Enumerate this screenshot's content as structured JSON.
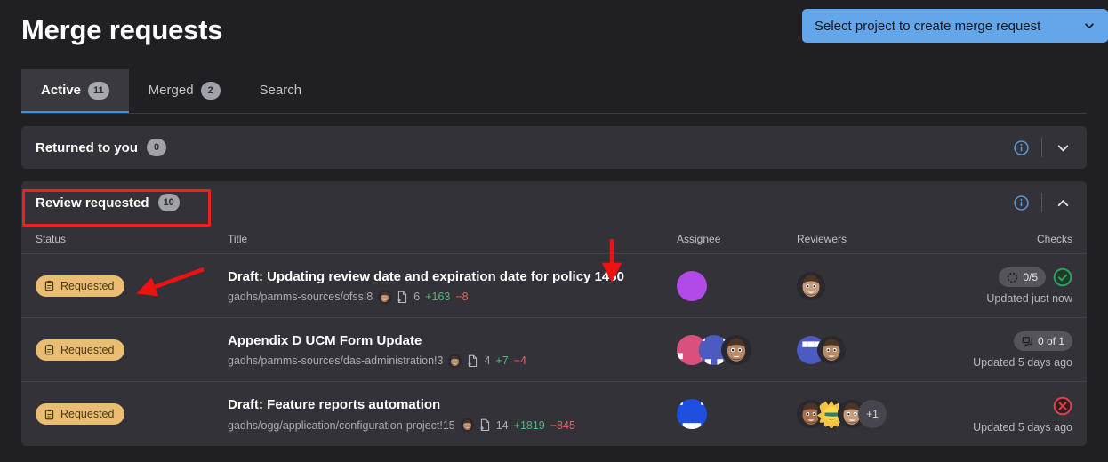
{
  "header": {
    "title": "Merge requests",
    "create_button": {
      "label": "Select project to create merge request",
      "icon": "chevron-down-icon",
      "color": "#63a6e9"
    }
  },
  "tabs": [
    {
      "label": "Active",
      "count": "11",
      "active": true
    },
    {
      "label": "Merged",
      "count": "2",
      "active": false
    },
    {
      "label": "Search",
      "count": "",
      "active": false
    }
  ],
  "sections": [
    {
      "title": "Returned to you",
      "count": "0",
      "expanded": false,
      "toggle_icon": "chevron-down-icon",
      "info_icon": "info-icon"
    },
    {
      "title": "Review requested",
      "count": "10",
      "expanded": true,
      "toggle_icon": "chevron-up-icon",
      "info_icon": "info-icon",
      "highlighted": true
    }
  ],
  "columns": {
    "status": "Status",
    "title": "Title",
    "assignee": "Assignee",
    "reviewers": "Reviewers",
    "checks": "Checks"
  },
  "rows": [
    {
      "status": "Requested",
      "status_icon": "clipboard-icon",
      "title": "Draft: Updating review date and expiration date for policy 1460",
      "path": "gadhs/pamms-sources/ofss!8",
      "files": "6",
      "additions": "+163",
      "deletions": "−8",
      "assignees": [
        {
          "type": "identicon",
          "color": "#b14ae8"
        }
      ],
      "reviewers": [
        {
          "type": "face",
          "color": "#c89b7b"
        }
      ],
      "checks_badge": "0/5",
      "checks_badge_icon": "task-dashed-icon",
      "pipeline_status": "success",
      "pipeline_icon": "check-circle-icon",
      "updated": "Updated just now"
    },
    {
      "status": "Requested",
      "status_icon": "clipboard-icon",
      "title": "Appendix D UCM Form Update",
      "path": "gadhs/pamms-sources/das-administration!3",
      "files": "4",
      "additions": "+7",
      "deletions": "−4",
      "assignees": [
        {
          "type": "identicon",
          "color": "#d94f7e"
        },
        {
          "type": "identicon",
          "color": "#4b5bbf"
        },
        {
          "type": "face",
          "color": "#b98a67"
        }
      ],
      "reviewers": [
        {
          "type": "identicon",
          "color": "#4b5bbf"
        },
        {
          "type": "face",
          "color": "#b98a67"
        }
      ],
      "checks_badge": "0 of 1",
      "checks_badge_icon": "comments-icon",
      "pipeline_status": "none",
      "pipeline_icon": "",
      "updated": "Updated 5 days ago"
    },
    {
      "status": "Requested",
      "status_icon": "clipboard-icon",
      "title": "Draft: Feature reports automation",
      "path": "gadhs/ogg/application/configuration-project!15",
      "files": "14",
      "additions": "+1819",
      "deletions": "−845",
      "assignees": [
        {
          "type": "identicon",
          "color": "#1f4fe0"
        }
      ],
      "reviewers": [
        {
          "type": "face",
          "color": "#a9704d"
        },
        {
          "type": "sun",
          "color": "#f5c542"
        },
        {
          "type": "face",
          "color": "#c89b7b"
        }
      ],
      "reviewers_overflow": "+1",
      "checks_badge": "",
      "checks_badge_icon": "",
      "pipeline_status": "failed",
      "pipeline_icon": "x-circle-icon",
      "updated": "Updated 5 days ago"
    }
  ],
  "annotations": {
    "box_color": "#ee2222",
    "arrow_color": "#ee1111"
  }
}
